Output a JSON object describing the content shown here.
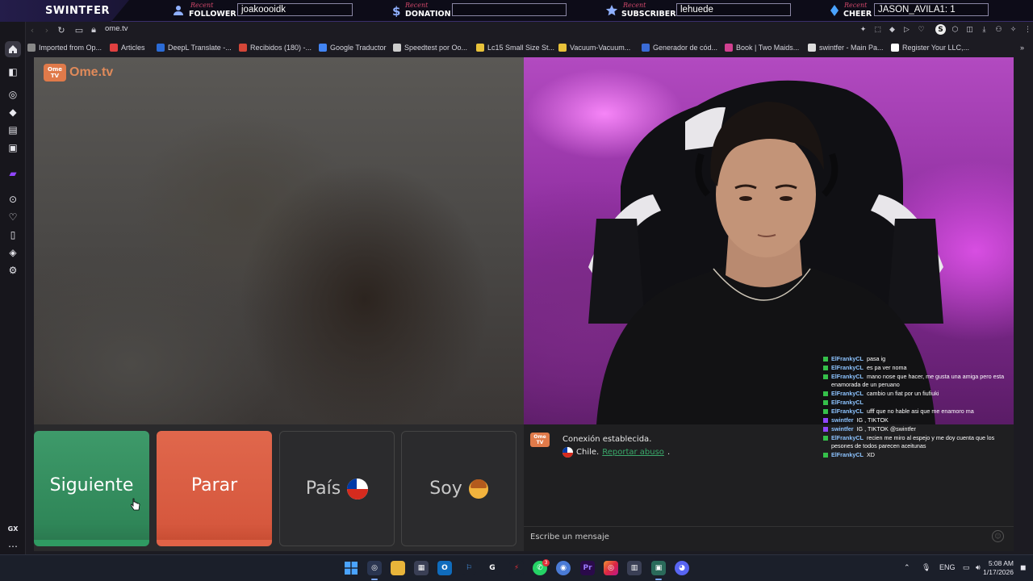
{
  "overlay": {
    "brand": "SWINTFER",
    "recent_label": "Recent",
    "follower": {
      "label": "FOLLOWER",
      "value": "joakoooidk",
      "icon": "user-plus-icon",
      "color": "#8fb0ff"
    },
    "donation": {
      "label": "DONATION",
      "value": "",
      "icon": "dollar-icon",
      "color": "#8fb0ff"
    },
    "subscriber": {
      "label": "SUBSCRIBER",
      "value": "lehuede",
      "icon": "star-icon",
      "color": "#8fb0ff"
    },
    "cheer": {
      "label": "CHEER",
      "value": "JASON_AVILA1: 1",
      "icon": "diamond-icon",
      "color": "#4aa3ff"
    }
  },
  "browser": {
    "address": "ome.tv",
    "bookmarks": [
      {
        "label": "Imported from Op...",
        "icon": "folder-icon",
        "color": "#888888"
      },
      {
        "label": "Articles",
        "icon": "bookmark-icon",
        "color": "#e04040"
      },
      {
        "label": "DeepL Translate -...",
        "icon": "deepl-icon",
        "color": "#2b6bd6"
      },
      {
        "label": "Recibidos (180) -...",
        "icon": "gmail-icon",
        "color": "#d44638"
      },
      {
        "label": "Google Traductor",
        "icon": "google-translate-icon",
        "color": "#4285f4"
      },
      {
        "label": "Speedtest por Oo...",
        "icon": "speedtest-icon",
        "color": "#cccccc"
      },
      {
        "label": "Lc15 Small Size St...",
        "icon": "bookmark-icon",
        "color": "#e8c23a"
      },
      {
        "label": "Vacuum-Vacuum...",
        "icon": "bookmark-icon",
        "color": "#e8c23a"
      },
      {
        "label": "Generador de cód...",
        "icon": "grid-icon",
        "color": "#3a6bd6"
      },
      {
        "label": "Book | Two Maids...",
        "icon": "bookmark-icon",
        "color": "#d04090"
      },
      {
        "label": "swintfer - Main Pa...",
        "icon": "bookmark-icon",
        "color": "#dddddd"
      },
      {
        "label": "Register Your LLC,...",
        "icon": "bookmark-icon",
        "color": "#ffffff"
      }
    ],
    "gx_label": "GX"
  },
  "ometv": {
    "logo_badge": "Ome TV",
    "logo_text": "Ome.tv",
    "buttons": {
      "next": "Siguiente",
      "stop": "Parar",
      "country": "País",
      "gender": "Soy"
    },
    "chat": {
      "badge": "Ome TV",
      "connected": "Conexión establecida.",
      "country": "Chile.",
      "report": "Reportar abuso",
      "placeholder": "Escribe un mensaje"
    }
  },
  "twitch_chat": [
    {
      "user": "ElFrankyCL",
      "text": "pasa ig",
      "badge": "green"
    },
    {
      "user": "ElFrankyCL",
      "text": "es pa ver noma",
      "badge": "green"
    },
    {
      "user": "ElFrankyCL",
      "text": "mano nose que hacer, me gusta una amiga pero esta enamorada de un peruano",
      "badge": "green"
    },
    {
      "user": "ElFrankyCL",
      "text": "cambio un fiat por un fiufiuki",
      "badge": "green"
    },
    {
      "user": "ElFrankyCL",
      "text": "",
      "badge": "green"
    },
    {
      "user": "ElFrankyCL",
      "text": "ufff que no hable asi que me enamoro ma",
      "badge": "green"
    },
    {
      "user": "swintfer",
      "text": "IG , TIKTOK",
      "badge": "purple"
    },
    {
      "user": "swintfer",
      "text": "IG , TIKTOK @swintfer",
      "badge": "purple"
    },
    {
      "user": "ElFrankyCL",
      "text": "recien me miro al espejo y me doy cuenta que los pesones de todos parecen aceitunas",
      "badge": "green"
    },
    {
      "user": "ElFrankyCL",
      "text": "XD",
      "badge": "green"
    }
  ],
  "taskbar": {
    "language": "ENG",
    "time": "5:08 AM",
    "date": "1/17/2026",
    "whatsapp_badge": "3"
  }
}
